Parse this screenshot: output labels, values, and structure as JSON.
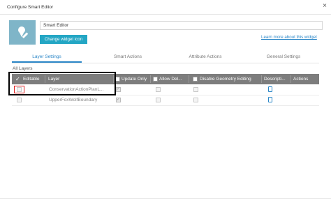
{
  "dialog": {
    "title": "Configure Smart Editor",
    "close_glyph": "×"
  },
  "widget": {
    "name": "Smart Editor",
    "change_icon_label": "Change widget icon",
    "learn_more": "Learn more about this widget",
    "icon": "pencil-icon"
  },
  "tabs": [
    {
      "label": "Layer Settings",
      "active": true
    },
    {
      "label": "Smart Actions",
      "active": false
    },
    {
      "label": "Attribute Actions",
      "active": false
    },
    {
      "label": "General Settings",
      "active": false
    }
  ],
  "all_layers_label": "All Layers",
  "table": {
    "columns": {
      "editable": "Editable",
      "layer": "Layer",
      "update_only": "Update Only",
      "allow_delete": "Allow Del...",
      "disable_geometry": "Disable Geometry Editing",
      "description": "Descripti...",
      "actions": "Actions"
    },
    "rows": [
      {
        "layer": "ConservationActionPlanL...",
        "editable": false,
        "update_only": true,
        "allow_delete": false,
        "disable_geometry": false
      },
      {
        "layer": "UpperFoxWolfBoundary",
        "editable": false,
        "update_only": true,
        "allow_delete": false,
        "disable_geometry": false
      }
    ]
  },
  "colors": {
    "accent": "#2a86c7",
    "button": "#23a6c4",
    "header": "#7d7d7d",
    "highlight_box": "#000000",
    "highlight_red": "#e02020"
  }
}
